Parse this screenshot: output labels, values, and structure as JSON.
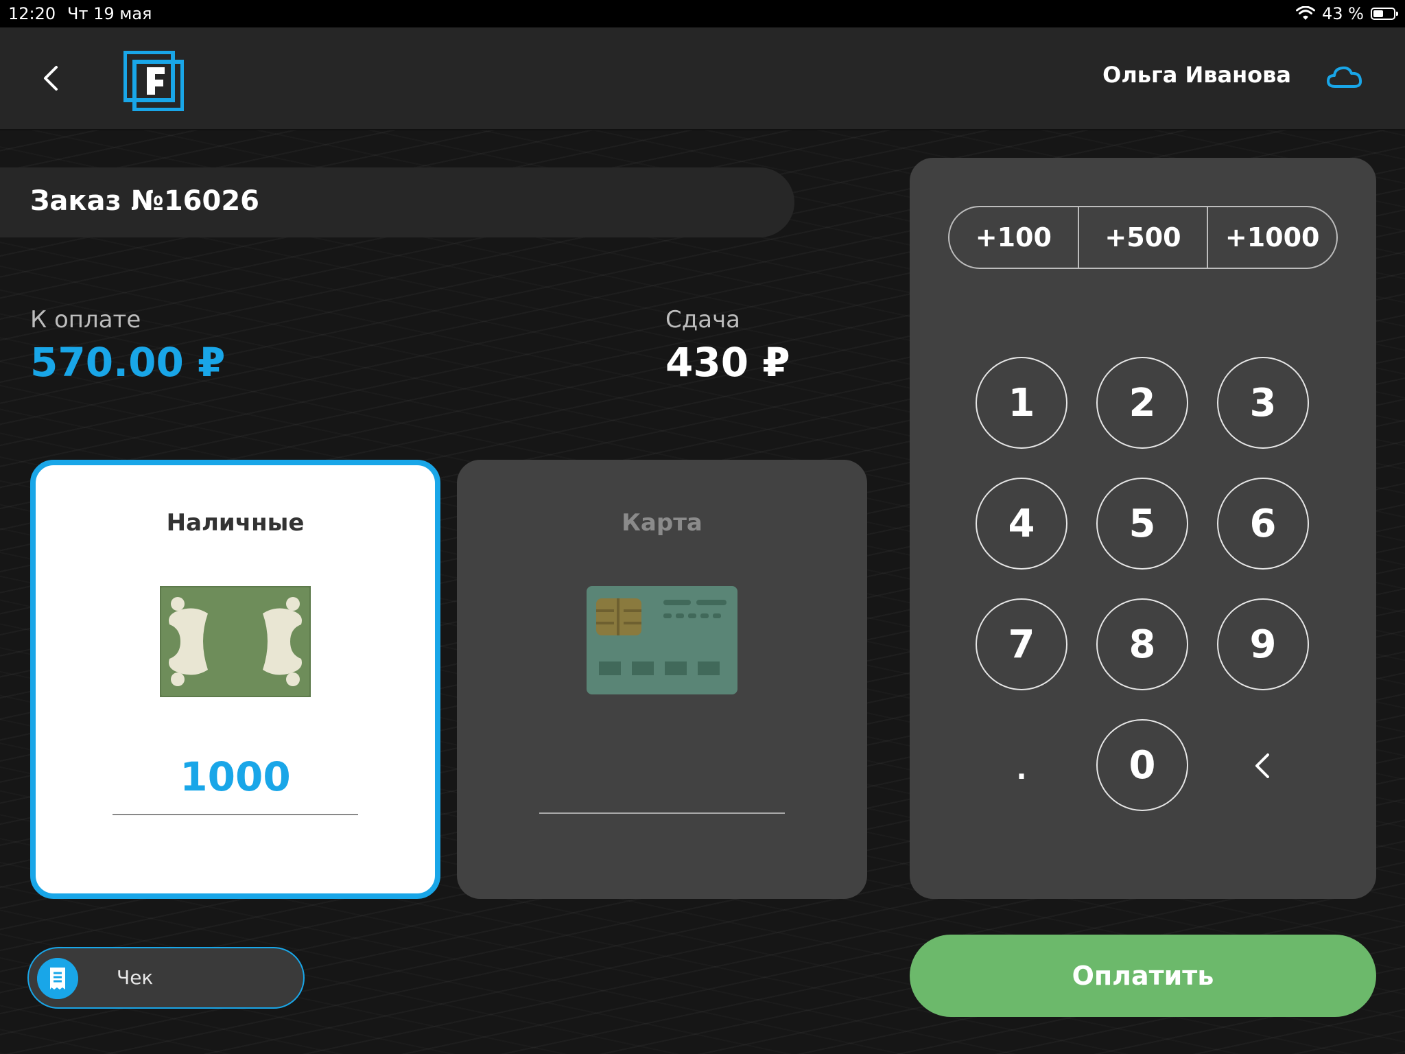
{
  "status_bar": {
    "time": "12:20",
    "date": "Чт 19 мая",
    "battery_text": "43 %",
    "battery_level": 0.43
  },
  "header": {
    "user_name": "Ольга Иванова",
    "logo_letter": "F"
  },
  "order": {
    "title": "Заказ №16026"
  },
  "summary": {
    "due_label": "К оплате",
    "due_value": "570.00 ₽",
    "change_label": "Сдача",
    "change_value": "430 ₽"
  },
  "payment_methods": {
    "cash": {
      "label": "Наличные",
      "value": "1000",
      "selected": true
    },
    "card": {
      "label": "Карта",
      "value": "",
      "selected": false
    }
  },
  "check": {
    "label": "Чек"
  },
  "quick_add": [
    "+100",
    "+500",
    "+1000"
  ],
  "keypad": {
    "digits": [
      "1",
      "2",
      "3",
      "4",
      "5",
      "6",
      "7",
      "8",
      "9",
      "0"
    ],
    "decimal": "."
  },
  "pay_button": {
    "label": "Оплатить"
  },
  "colors": {
    "accent": "#19a6e8",
    "pay": "#6cb96b",
    "panel": "#414141"
  }
}
